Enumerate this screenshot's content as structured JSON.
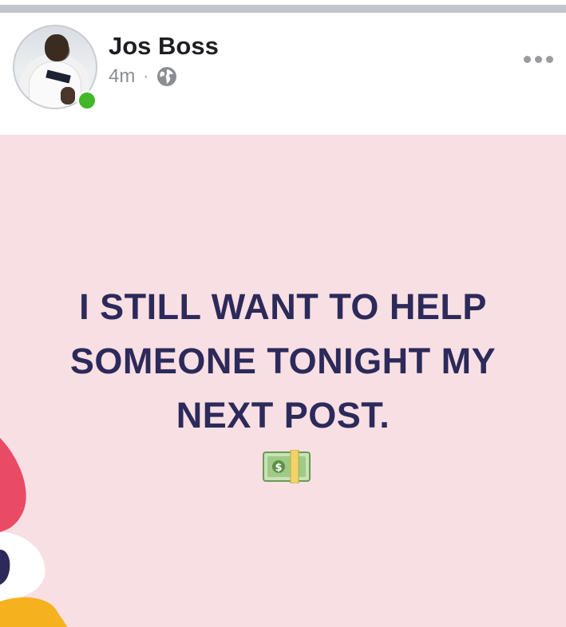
{
  "post": {
    "author": "Jos Boss",
    "time": "4m",
    "separator": "·",
    "audience_icon": "globe-icon",
    "more_icon": "more-options-icon",
    "text": "I STILL WANT TO HELP\nSOMEONE TONIGHT MY\nNEXT POST.",
    "emoji": "money-banknote-icon",
    "background_color": "#f8dfe3",
    "text_color": "#2c2a5a"
  },
  "status": {
    "online": true,
    "online_color": "#42b72a"
  }
}
